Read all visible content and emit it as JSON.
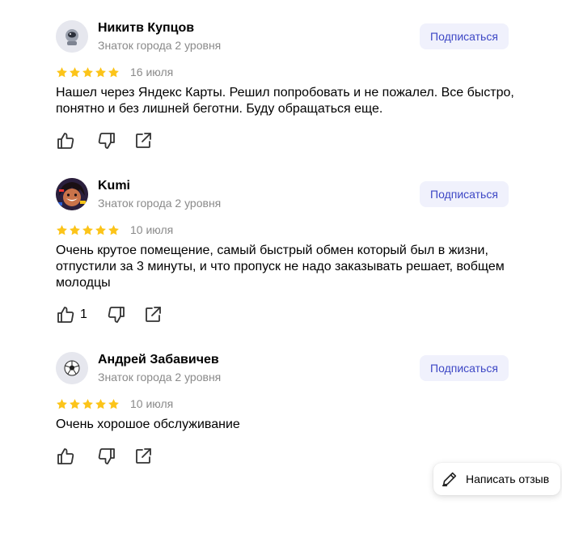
{
  "reviews": [
    {
      "author": "Никитв Купцов",
      "level": "Знаток города 2 уровня",
      "subscribe": "Подписаться",
      "rating": 5,
      "date": "16 июля",
      "text": "Нашел через Яндекс Карты. Решил попробовать и не пожалел. Все быстро, понятно и без лишней беготни. Буду обращаться еще.",
      "likes": ""
    },
    {
      "author": "Kumi",
      "level": "Знаток города 2 уровня",
      "subscribe": "Подписаться",
      "rating": 5,
      "date": "10 июля",
      "text": "Очень крутое помещение, самый быстрый обмен который был в жизни, отпустили за 3 минуты, и что пропуск не надо заказывать решает, вобщем молодцы",
      "likes": "1"
    },
    {
      "author": "Андрей Забавичев",
      "level": "Знаток города 2 уровня",
      "subscribe": "Подписаться",
      "rating": 5,
      "date": "10 июля",
      "text": "Очень хорошое обслуживание",
      "likes": ""
    }
  ],
  "write_review": "Написать отзыв",
  "colors": {
    "star": "#fcc419",
    "subscribe_bg": "#f0f1fc",
    "subscribe_text": "#3d47c5",
    "muted": "#8a8a8a"
  },
  "icons": [
    "astronaut-avatar-icon",
    "anime-avatar-icon",
    "soccer-ball-avatar-icon",
    "star-icon",
    "thumbs-up-icon",
    "thumbs-down-icon",
    "share-icon",
    "pen-icon"
  ]
}
